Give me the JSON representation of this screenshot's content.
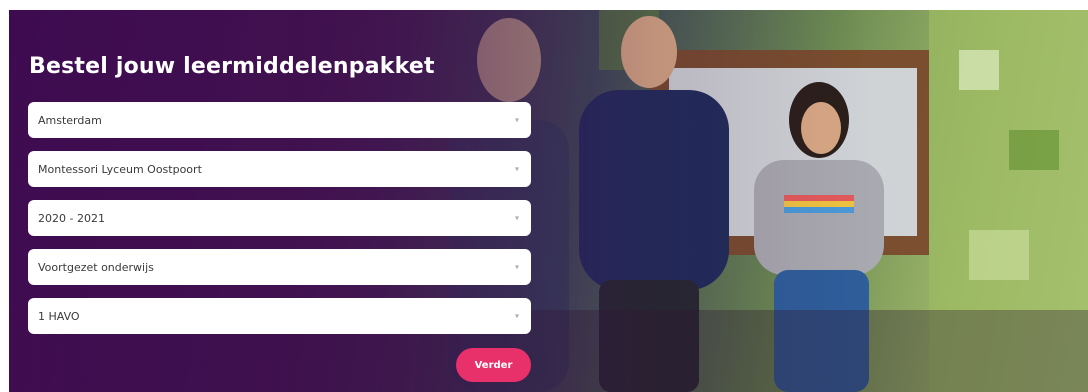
{
  "hero": {
    "title": "Bestel jouw leermiddelenpakket"
  },
  "form": {
    "fields": [
      {
        "value": "Amsterdam"
      },
      {
        "value": "Montessori Lyceum Oostpoort"
      },
      {
        "value": "2020 - 2021"
      },
      {
        "value": "Voortgezet onderwijs"
      },
      {
        "value": "1 HAVO"
      }
    ],
    "arrow": "▾",
    "submit_label": "Verder"
  },
  "colors": {
    "accent": "#e8306a",
    "overlay": "#5a1470"
  },
  "icons": {
    "select_arrow": "chevron-down-icon"
  }
}
